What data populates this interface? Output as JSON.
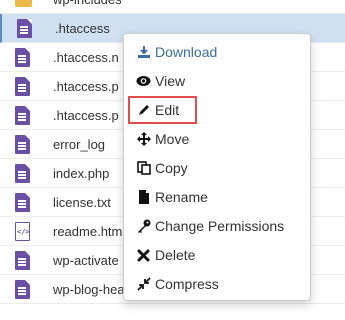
{
  "files": [
    {
      "name": "wp-includes",
      "icon": "folder-icon"
    },
    {
      "name": ".htaccess",
      "icon": "file-icon",
      "selected": true
    },
    {
      "name": ".htaccess.n",
      "icon": "file-icon"
    },
    {
      "name": ".htaccess.p",
      "icon": "file-icon"
    },
    {
      "name": ".htaccess.p",
      "icon": "file-icon"
    },
    {
      "name": "error_log",
      "icon": "file-icon"
    },
    {
      "name": "index.php",
      "icon": "file-icon"
    },
    {
      "name": "license.txt",
      "icon": "file-icon"
    },
    {
      "name": "readme.htm",
      "icon": "code-file-icon"
    },
    {
      "name": "wp-activate",
      "icon": "file-icon"
    },
    {
      "name": "wp-blog-header.php",
      "icon": "file-icon"
    }
  ],
  "menu": [
    {
      "label": "Download",
      "icon": "download-icon"
    },
    {
      "label": "View",
      "icon": "eye-icon"
    },
    {
      "label": "Edit",
      "icon": "pencil-icon"
    },
    {
      "label": "Move",
      "icon": "move-arrows-icon"
    },
    {
      "label": "Copy",
      "icon": "copy-icon"
    },
    {
      "label": "Rename",
      "icon": "file-icon"
    },
    {
      "label": "Change Permissions",
      "icon": "key-icon"
    },
    {
      "label": "Delete",
      "icon": "x-icon"
    },
    {
      "label": "Compress",
      "icon": "compress-icon"
    }
  ],
  "colors": {
    "selected_row": "#cfe0f3",
    "file_icon": "#6b4fa4",
    "download_text": "#3a6ea5",
    "highlight_border": "#e14c4c"
  }
}
